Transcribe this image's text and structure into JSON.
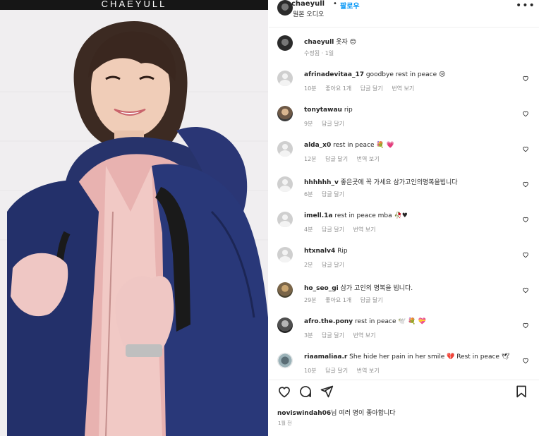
{
  "photo": {
    "brand": "CHAEYULL"
  },
  "header": {
    "username": "chaeyull",
    "dot": "•",
    "follow_label": "팔로우",
    "audio_label": "원본 오디오",
    "more_icon": "more-horizontal-icon"
  },
  "caption": {
    "username": "chaeyull",
    "text": "옷자 😊",
    "meta": "수정됨 · 1일"
  },
  "comments": [
    {
      "user": "afrinadevitaa_17",
      "text": "goodbye rest in peace 😢",
      "time": "10분",
      "likes": "좋아요 1개",
      "reply": "답글 달기",
      "translate": "번역 보기"
    },
    {
      "user": "tonytawau",
      "text": "rip",
      "time": "9분",
      "likes": "",
      "reply": "답글 달기",
      "translate": ""
    },
    {
      "user": "alda_x0",
      "text": "rest in peace 💐 💗",
      "time": "12분",
      "likes": "",
      "reply": "답글 달기",
      "translate": "번역 보기"
    },
    {
      "user": "hhhhhh_v",
      "text": "좋은곳에 꼭 가세요 삼가고인의명복을빕니다",
      "time": "6분",
      "likes": "",
      "reply": "답글 달기",
      "translate": ""
    },
    {
      "user": "imell.1a",
      "text": "rest in peace mba 🥀♥",
      "time": "4분",
      "likes": "",
      "reply": "답글 달기",
      "translate": "번역 보기"
    },
    {
      "user": "htxnalv4",
      "text": "Rip",
      "time": "2분",
      "likes": "",
      "reply": "답글 달기",
      "translate": ""
    },
    {
      "user": "ho_seo_gi",
      "text": "삼가 고인의 명복을 빕니다.",
      "time": "29분",
      "likes": "좋아요 1개",
      "reply": "답글 달기",
      "translate": ""
    },
    {
      "user": "afro.the.pony",
      "text": "rest in peace 🕊️ 💐 💝",
      "time": "3분",
      "likes": "",
      "reply": "답글 달기",
      "translate": "번역 보기"
    },
    {
      "user": "riaamaliaa.r",
      "text": "She hide her pain in her smile 💔 Rest in peace 🕊",
      "time": "10분",
      "likes": "",
      "reply": "답글 달기",
      "translate": "번역 보기"
    }
  ],
  "footer": {
    "likes_user": "noviswindah06",
    "likes_text": "님 여러 명이 좋아합니다",
    "likes_text_bold": "여러 명",
    "date": "1월 전"
  },
  "icons": [
    "heart-icon",
    "comment-icon",
    "share-icon",
    "bookmark-icon"
  ]
}
